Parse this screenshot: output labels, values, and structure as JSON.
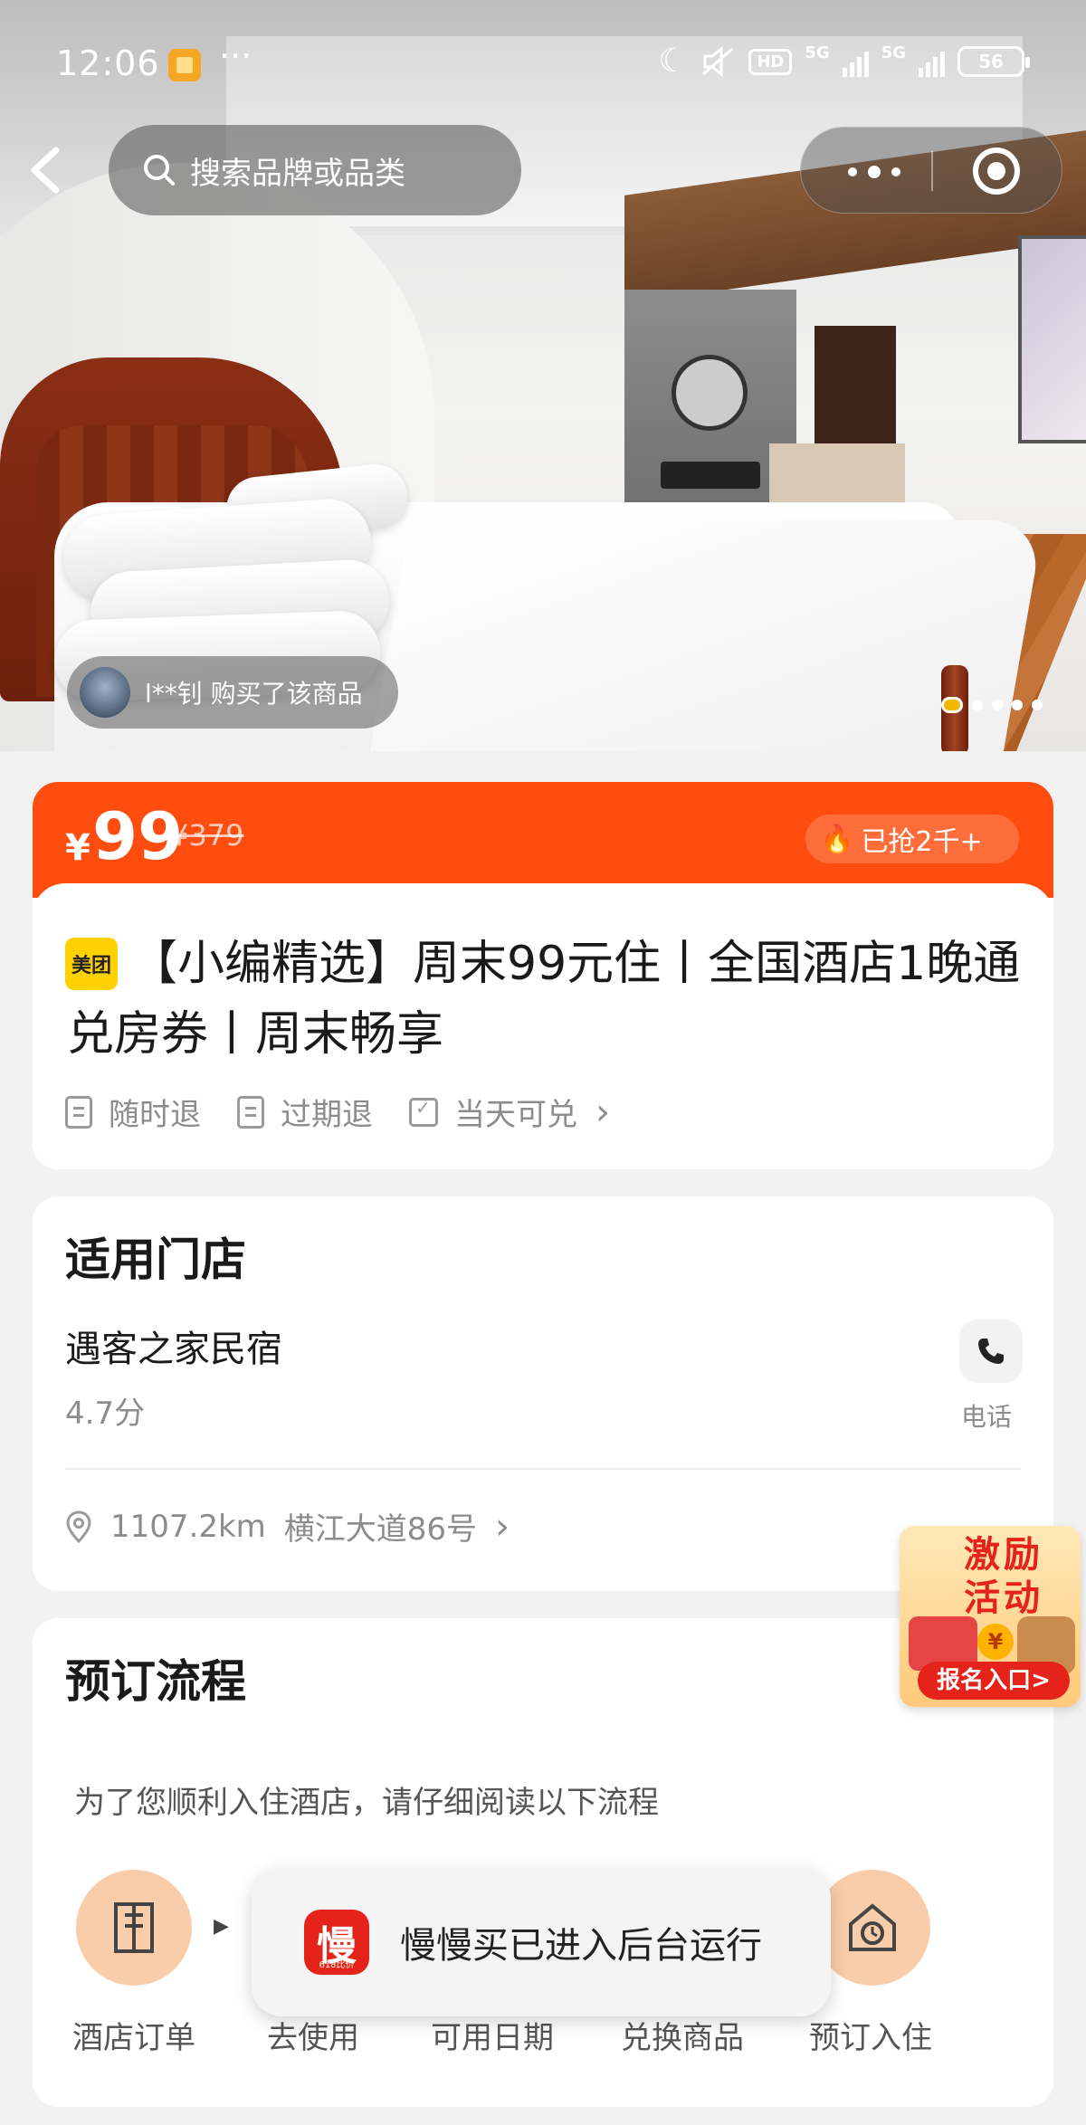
{
  "status_bar": {
    "time": "12:06",
    "more": "···",
    "battery": "56",
    "hd_label": "HD",
    "network": "5G"
  },
  "top_bar": {
    "search_placeholder": "搜索品牌或品类"
  },
  "hero": {
    "buyer_text": "l**钊 购买了该商品",
    "carousel_count": 5,
    "carousel_active": 1
  },
  "price_card": {
    "currency": "¥",
    "price": "99",
    "original_price": "¥379",
    "sold_label": "已抢2千+",
    "brand_badge": "美团",
    "title": "【小编精选】周末99元住丨全国酒店1晚通兑房券丨周末畅享",
    "policies": [
      "随时退",
      "过期退",
      "当天可兑"
    ]
  },
  "store_card": {
    "section_title": "适用门店",
    "store_name": "遇客之家民宿",
    "rating": "4.7分",
    "phone_label": "电话",
    "distance": "1107.2km",
    "address": "横江大道86号"
  },
  "promo": {
    "title": "激励活动",
    "coin": "¥",
    "button": "报名入口>"
  },
  "booking_card": {
    "section_title": "预订流程",
    "note": "为了您顺利入住酒店，请仔细阅读以下流程",
    "steps": [
      "酒店订单",
      "去使用",
      "可用日期",
      "兑换商品",
      "预订入住"
    ]
  },
  "toast": {
    "app_icon_text": "慢",
    "app_icon_sub": "618比价",
    "message": "慢慢买已进入后台运行"
  },
  "colors": {
    "accent": "#ff4d10",
    "brand_yellow": "#ffd100",
    "step_bg": "#f9cda9",
    "promo_red": "#e5231b"
  }
}
